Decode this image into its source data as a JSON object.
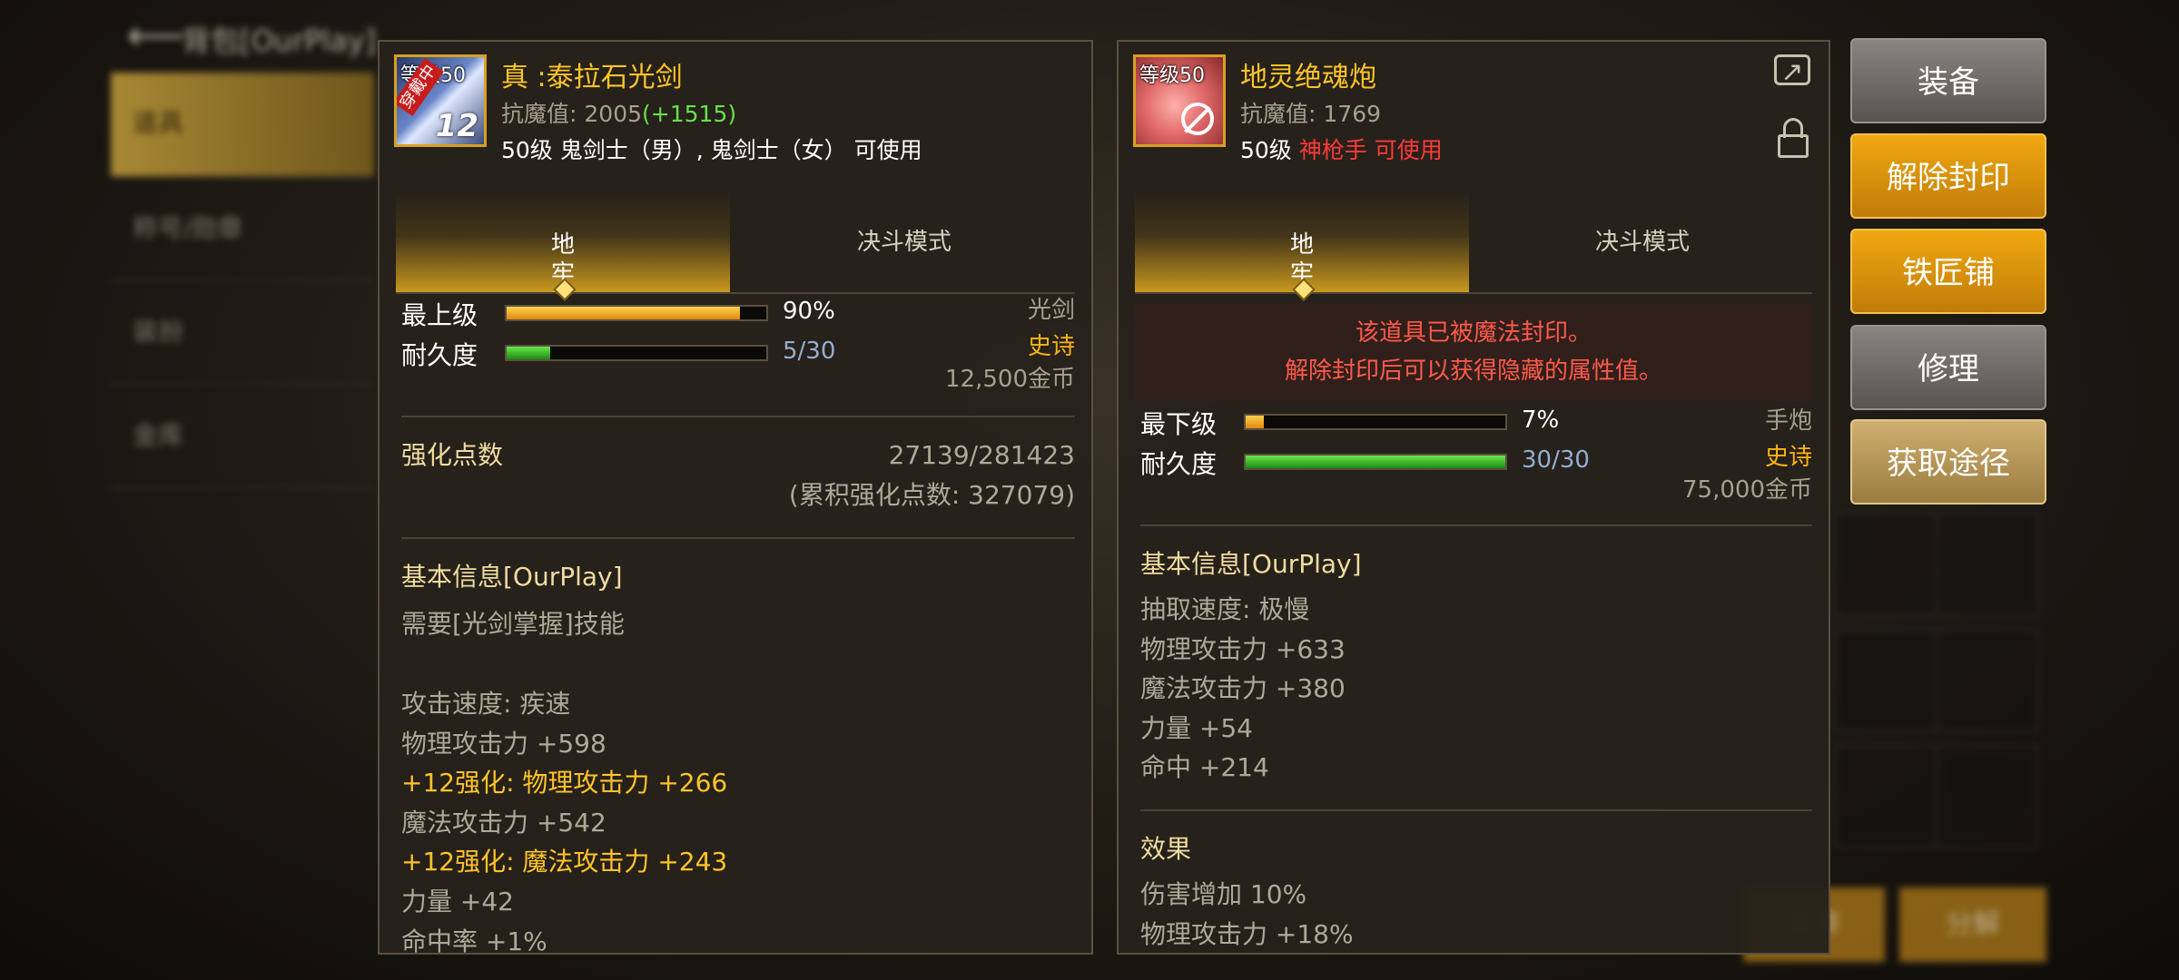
{
  "background": {
    "title": "背包[OurPlay]",
    "menu": [
      "道具",
      "称号/勋章",
      "装扮",
      "金库"
    ],
    "bottom_buttons": [
      "丢弃",
      "分解"
    ]
  },
  "left_item": {
    "icon_level_tag": "等级50",
    "equipped_badge": "穿戴中",
    "reinforce_level": "12",
    "name": "真 :泰拉石光剑",
    "resist_label": "抗魔值:",
    "resist_value": "2005",
    "resist_bonus": "(+1515)",
    "usable_text": "50级 鬼剑士（男）, 鬼剑士（女） 可使用",
    "tabs": [
      "地牢",
      "决斗模式"
    ],
    "grade_label": "最上级",
    "grade_percent": 90,
    "grade_value": "90%",
    "durability_label": "耐久度",
    "durability_current": 5,
    "durability_max": 30,
    "durability_value": "5/30",
    "item_type": "光剑",
    "rarity": "史诗",
    "price": "12,500金币",
    "reinforce_points_label": "强化点数",
    "reinforce_points_value": "27139/281423",
    "reinforce_accum": "(累积强化点数: 327079)",
    "basic_info_title": "基本信息[OurPlay]",
    "skill_req": "需要[光剑掌握]技能",
    "stats": [
      {
        "text": "攻击速度:  疾速",
        "style": "gray"
      },
      {
        "text": "物理攻击力 +598",
        "style": "gray"
      },
      {
        "text": "+12强化:  物理攻击力 +266",
        "style": "gold"
      },
      {
        "text": "魔法攻击力 +542",
        "style": "gray"
      },
      {
        "text": "+12强化:  魔法攻击力 +243",
        "style": "gold"
      },
      {
        "text": "力量 +42",
        "style": "gray"
      },
      {
        "text": "命中率 +1%",
        "style": "gray"
      }
    ]
  },
  "right_item": {
    "icon_level_tag": "等级50",
    "name": "地灵绝魂炮",
    "resist_label": "抗魔值:",
    "resist_value": "1769",
    "usable_level": "50级",
    "usable_class": "神枪手 可使用",
    "tabs": [
      "地牢",
      "决斗模式"
    ],
    "sealed_line1": "该道具已被魔法封印。",
    "sealed_line2": "解除封印后可以获得隐藏的属性值。",
    "grade_label": "最下级",
    "grade_percent": 7,
    "grade_value": "7%",
    "durability_label": "耐久度",
    "durability_current": 30,
    "durability_max": 30,
    "durability_value": "30/30",
    "item_type": "手炮",
    "rarity": "史诗",
    "price": "75,000金币",
    "basic_info_title": "基本信息[OurPlay]",
    "stats": [
      "抽取速度:  极慢",
      "物理攻击力 +633",
      "魔法攻击力 +380",
      "力量 +54",
      "命中 +214"
    ],
    "effects_title": "效果",
    "effects": [
      "伤害增加 10%",
      "物理攻击力 +18%"
    ]
  },
  "side_buttons": [
    "装备",
    "解除封印",
    "铁匠铺",
    "修理",
    "获取途径"
  ],
  "colors": {
    "item_name": "#ffc42a",
    "rarity": "#ffb40e",
    "warning": "#ff5a4a",
    "bonus_green": "#69e04a",
    "button_gold": "#e09a0c"
  }
}
